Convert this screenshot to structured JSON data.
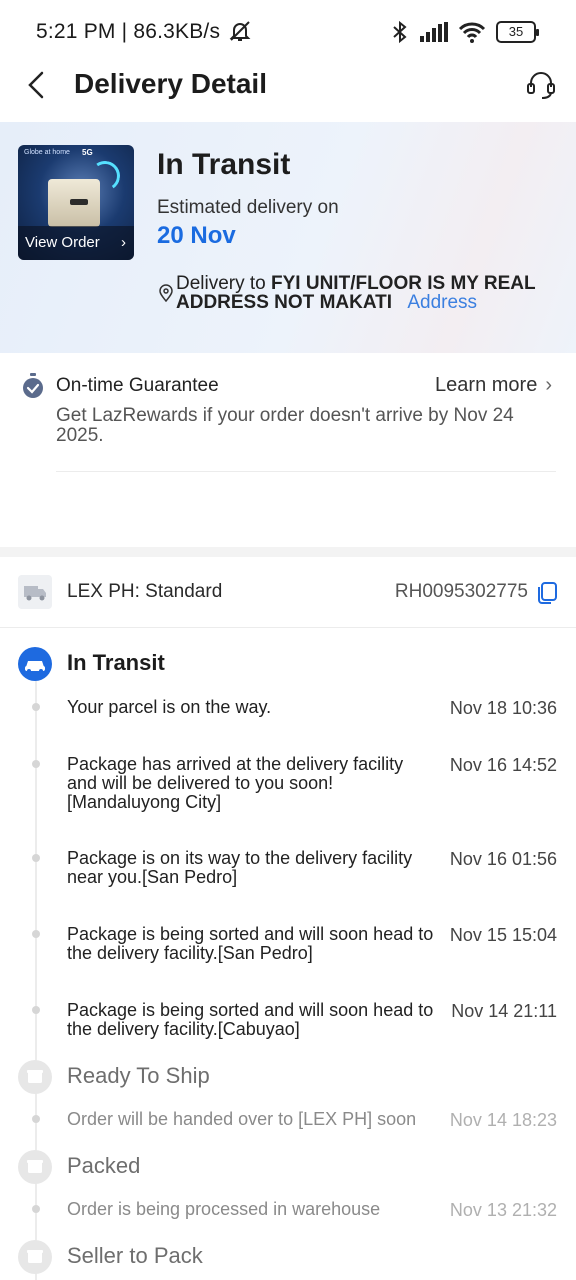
{
  "status_bar": {
    "time_speed": "5:21 PM | 86.3KB/s",
    "battery": "35"
  },
  "header": {
    "title": "Delivery Detail"
  },
  "hero": {
    "status": "In Transit",
    "estimate_label": "Estimated delivery on",
    "estimate_date": "20 Nov",
    "view_order": "View Order",
    "thumb_brand": "Globe at home",
    "thumb_badge": "5G",
    "delivery_prefix": "Delivery to",
    "delivery_address": "FYI UNIT/FLOOR IS MY REAL ADDRESS NOT MAKATI",
    "address_link": "Address"
  },
  "guarantee": {
    "title": "On-time Guarantee",
    "learn_more": "Learn more",
    "description": "Get LazRewards if your order doesn't arrive by Nov 24 2025."
  },
  "courier": {
    "name": "LEX PH: Standard",
    "tracking_number": "RH0095302775"
  },
  "timeline": [
    {
      "title": "In Transit",
      "state": "active",
      "events": [
        {
          "text": "Your parcel is on the way.",
          "time": "Nov 18 10:36"
        },
        {
          "text": "Package has arrived at the delivery facility and will be delivered to you soon![Mandaluyong City]",
          "time": "Nov 16 14:52"
        },
        {
          "text": "Package is on its way to the delivery facility near you.[San Pedro]",
          "time": "Nov 16 01:56"
        },
        {
          "text": "Package is being sorted and will soon head to the delivery facility.[San Pedro]",
          "time": "Nov 15 15:04"
        },
        {
          "text": "Package is being sorted and will soon head to the delivery facility.[Cabuyao]",
          "time": "Nov 14 21:11"
        }
      ]
    },
    {
      "title": "Ready To Ship",
      "state": "done",
      "events": [
        {
          "text": "Order will be handed over to [LEX PH] soon",
          "time": "Nov 14 18:23"
        }
      ]
    },
    {
      "title": "Packed",
      "state": "done",
      "events": [
        {
          "text": "Order is being processed in warehouse",
          "time": "Nov 13 21:32"
        }
      ]
    },
    {
      "title": "Seller to Pack",
      "state": "done",
      "events": []
    }
  ]
}
